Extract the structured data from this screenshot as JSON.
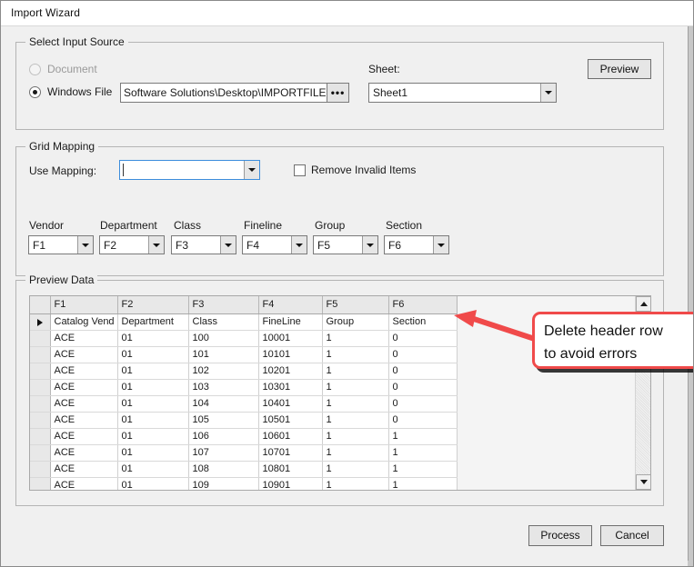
{
  "window": {
    "title": "Import Wizard"
  },
  "input_source": {
    "legend": "Select Input Source",
    "radio_document_label": "Document",
    "radio_windows_file_label": "Windows File",
    "file_path_value": "Software Solutions\\Desktop\\IMPORTFILE.xls",
    "browse_label": "•••",
    "sheet_label": "Sheet:",
    "sheet_value": "Sheet1",
    "preview_button_label": "Preview"
  },
  "grid_mapping": {
    "legend": "Grid Mapping",
    "use_mapping_label": "Use Mapping:",
    "use_mapping_value": "",
    "remove_invalid_label": "Remove Invalid Items",
    "fields": [
      {
        "label": "Vendor",
        "value": "F1"
      },
      {
        "label": "Department",
        "value": "F2"
      },
      {
        "label": "Class",
        "value": "F3"
      },
      {
        "label": "Fineline",
        "value": "F4"
      },
      {
        "label": "Group",
        "value": "F5"
      },
      {
        "label": "Section",
        "value": "F6"
      }
    ]
  },
  "preview_data": {
    "legend": "Preview Data",
    "columns": [
      "F1",
      "F2",
      "F3",
      "F4",
      "F5",
      "F6"
    ],
    "rows": [
      [
        "Catalog Vend",
        "Department",
        "Class",
        "FineLine",
        "Group",
        "Section"
      ],
      [
        "ACE",
        "01",
        "100",
        "10001",
        "1",
        "0"
      ],
      [
        "ACE",
        "01",
        "101",
        "10101",
        "1",
        "0"
      ],
      [
        "ACE",
        "01",
        "102",
        "10201",
        "1",
        "0"
      ],
      [
        "ACE",
        "01",
        "103",
        "10301",
        "1",
        "0"
      ],
      [
        "ACE",
        "01",
        "104",
        "10401",
        "1",
        "0"
      ],
      [
        "ACE",
        "01",
        "105",
        "10501",
        "1",
        "0"
      ],
      [
        "ACE",
        "01",
        "106",
        "10601",
        "1",
        "1"
      ],
      [
        "ACE",
        "01",
        "107",
        "10701",
        "1",
        "1"
      ],
      [
        "ACE",
        "01",
        "108",
        "10801",
        "1",
        "1"
      ],
      [
        "ACE",
        "01",
        "109",
        "10901",
        "1",
        "1"
      ]
    ]
  },
  "annotation": {
    "line1": "Delete header row",
    "line2": "to avoid errors",
    "color": "#f04a4a"
  },
  "footer": {
    "process_label": "Process",
    "cancel_label": "Cancel"
  }
}
